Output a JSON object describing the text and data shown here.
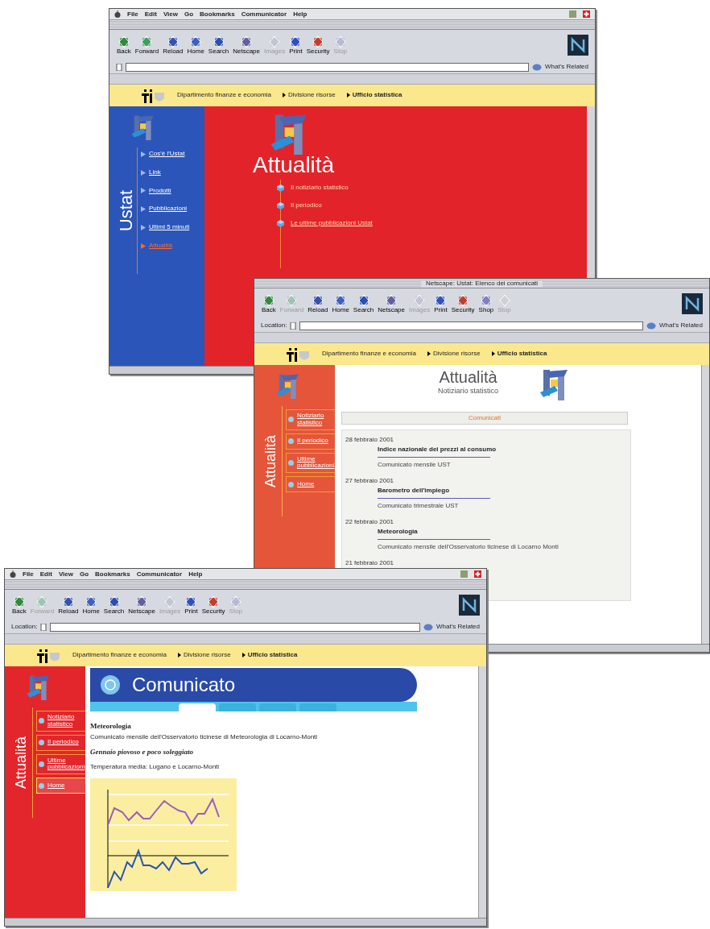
{
  "windows": [
    {
      "kind": "home",
      "menu_bar": {
        "items": [
          "File",
          "Edit",
          "View",
          "Go",
          "Bookmarks",
          "Communicator",
          "Help"
        ]
      },
      "toolbar": [
        {
          "label": "Back",
          "disabled": false
        },
        {
          "label": "Forward",
          "disabled": false
        },
        {
          "label": "Reload",
          "disabled": false
        },
        {
          "label": "Home",
          "disabled": false
        },
        {
          "label": "Search",
          "disabled": false
        },
        {
          "label": "Netscape",
          "disabled": false
        },
        {
          "label": "Images",
          "disabled": true
        },
        {
          "label": "Print",
          "disabled": false
        },
        {
          "label": "Security",
          "disabled": false
        },
        {
          "label": "Stop",
          "disabled": true
        }
      ],
      "related": "What's Related",
      "breadcrumbs": [
        "Dipartimento finanze e economia",
        "Divisione risorse",
        "Ufficio statistica"
      ],
      "sidebar": {
        "title": "Ustat",
        "items": [
          {
            "label": "Cos'è l'Ustat",
            "selected": false
          },
          {
            "label": "Link",
            "selected": false
          },
          {
            "label": "Prodotti",
            "selected": false
          },
          {
            "label": "Pubblicazioni",
            "selected": false
          },
          {
            "label": "Ultimi 5 minuti",
            "selected": false
          },
          {
            "label": "Attualità",
            "selected": true
          }
        ]
      },
      "heading": "Attualità",
      "links": [
        "Il notiziario statistico",
        "Il periodico",
        "Le ultime pubblicazioni Ustat"
      ]
    },
    {
      "kind": "list",
      "title": "Netscape: Ustat: Elenco dei comunicati",
      "toolbar": [
        {
          "label": "Back",
          "disabled": false
        },
        {
          "label": "Forward",
          "disabled": true
        },
        {
          "label": "Reload",
          "disabled": false
        },
        {
          "label": "Home",
          "disabled": false
        },
        {
          "label": "Search",
          "disabled": false
        },
        {
          "label": "Netscape",
          "disabled": false
        },
        {
          "label": "Images",
          "disabled": true
        },
        {
          "label": "Print",
          "disabled": false
        },
        {
          "label": "Security",
          "disabled": false
        },
        {
          "label": "Shop",
          "disabled": false
        },
        {
          "label": "Stop",
          "disabled": true
        }
      ],
      "location_label": "Location:",
      "related": "What's Related",
      "breadcrumbs": [
        "Dipartimento finanze e economia",
        "Divisione risorse",
        "Ufficio statistica"
      ],
      "sidebar": {
        "title": "Attualità",
        "items": [
          {
            "label": "Notiziario statistico",
            "selected": false
          },
          {
            "label": "Il periodico",
            "selected": false
          },
          {
            "label": "Ultime pubblicazioni",
            "selected": false
          },
          {
            "label": "Home",
            "selected": false
          }
        ]
      },
      "heading": "Attualità",
      "subheading": "Notiziario statistico",
      "section": "Comunicati",
      "entries": [
        {
          "date": "28 febbraio 2001",
          "title": "Indice nazionale dei prezzi al consumo",
          "note": "Comunicato mensile UST"
        },
        {
          "date": "27 febbraio 2001",
          "title": "Barometro dell'impiego",
          "note": "Comunicato trimestrale UST"
        },
        {
          "date": "22 febbraio 2001",
          "title": "Meteorologia",
          "note": "Comunicato mensile dell'Osservatorio ticinese di Locarno Monti"
        },
        {
          "date": "21 febbraio 2001"
        }
      ]
    },
    {
      "kind": "release",
      "menu_bar": {
        "items": [
          "File",
          "Edit",
          "View",
          "Go",
          "Bookmarks",
          "Communicator",
          "Help"
        ]
      },
      "toolbar": [
        {
          "label": "Back",
          "disabled": false
        },
        {
          "label": "Forward",
          "disabled": true
        },
        {
          "label": "Reload",
          "disabled": false
        },
        {
          "label": "Home",
          "disabled": false
        },
        {
          "label": "Search",
          "disabled": false
        },
        {
          "label": "Netscape",
          "disabled": false
        },
        {
          "label": "Images",
          "disabled": true
        },
        {
          "label": "Print",
          "disabled": false
        },
        {
          "label": "Security",
          "disabled": false
        },
        {
          "label": "Stop",
          "disabled": true
        }
      ],
      "location_label": "Location:",
      "related": "What's Related",
      "breadcrumbs": [
        "Dipartimento finanze e economia",
        "Divisione risorse",
        "Ufficio statistica"
      ],
      "sidebar": {
        "title": "Attualità",
        "items": [
          {
            "label": "Notiziario statistico",
            "selected": false
          },
          {
            "label": "Il periodico",
            "selected": false
          },
          {
            "label": "Ultime pubblicazioni",
            "selected": false
          },
          {
            "label": "Home",
            "selected": true
          }
        ]
      },
      "heading": "Comunicato",
      "tabs": [
        {
          "selected": true
        },
        {
          "selected": false
        },
        {
          "selected": false
        },
        {
          "selected": false
        }
      ],
      "release_title": "Meteorologia",
      "subtitle": "Comunicato mensile dell'Osservatorio ticinese di Meteorologia di Locarno-Monti",
      "headline": "Gennaio piovoso e poco soleggiato",
      "caption": "Temperatura media: Lugano e Locarno-Monti"
    }
  ]
}
